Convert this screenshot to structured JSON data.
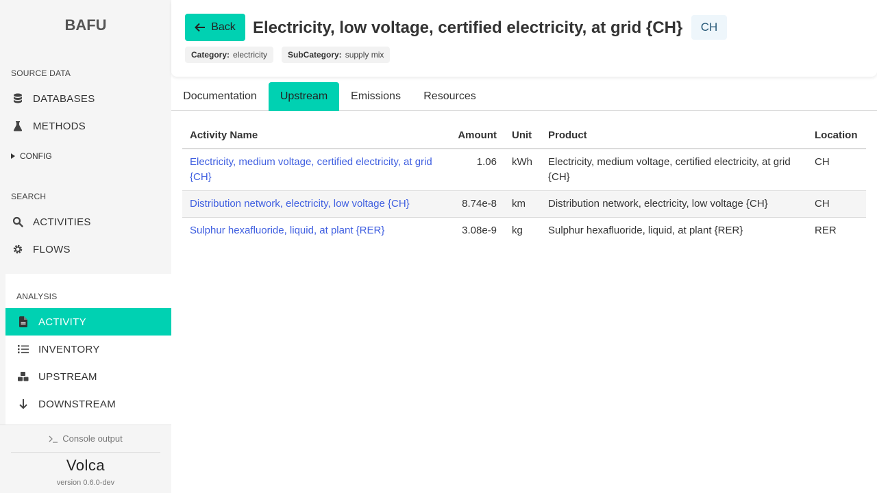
{
  "sidebar": {
    "brand": "BAFU",
    "source_label": "SOURCE DATA",
    "source_items": [
      {
        "label": "DATABASES",
        "icon": "database-icon"
      },
      {
        "label": "METHODS",
        "icon": "flask-icon"
      }
    ],
    "config_label": "CONFIG",
    "search_label": "SEARCH",
    "search_items": [
      {
        "label": "ACTIVITIES",
        "icon": "search-icon"
      },
      {
        "label": "FLOWS",
        "icon": "gear-icon"
      }
    ],
    "analysis_label": "ANALYSIS",
    "analysis_items": [
      {
        "label": "ACTIVITY",
        "icon": "document-icon",
        "active": true
      },
      {
        "label": "INVENTORY",
        "icon": "list-icon"
      },
      {
        "label": "UPSTREAM",
        "icon": "cubes-icon"
      },
      {
        "label": "DOWNSTREAM",
        "icon": "arrow-down-icon"
      }
    ],
    "console_label": "Console output",
    "logo": "Volca",
    "version": "version 0.6.0-dev"
  },
  "header": {
    "back_label": "Back",
    "title": "Electricity, low voltage, certified electricity, at grid {CH}",
    "location": "CH",
    "category_key": "Category:",
    "category_value": "electricity",
    "subcategory_key": "SubCategory:",
    "subcategory_value": "supply mix"
  },
  "tabs": [
    {
      "label": "Documentation"
    },
    {
      "label": "Upstream",
      "active": true
    },
    {
      "label": "Emissions"
    },
    {
      "label": "Resources"
    }
  ],
  "table": {
    "columns": [
      "Activity Name",
      "Amount",
      "Unit",
      "Product",
      "Location"
    ],
    "rows": [
      {
        "activity": "Electricity, medium voltage, certified electricity, at grid {CH}",
        "amount": "1.06",
        "unit": "kWh",
        "product": "Electricity, medium voltage, certified electricity, at grid {CH}",
        "location": "CH"
      },
      {
        "activity": "Distribution network, electricity, low voltage {CH}",
        "amount": "8.74e-8",
        "unit": "km",
        "product": "Distribution network, electricity, low voltage {CH}",
        "location": "CH"
      },
      {
        "activity": "Sulphur hexafluoride, liquid, at plant {RER}",
        "amount": "3.08e-9",
        "unit": "kg",
        "product": "Sulphur hexafluoride, liquid, at plant {RER}",
        "location": "RER"
      }
    ]
  },
  "colors": {
    "accent": "#00d1b2",
    "link": "#3e5ee0",
    "sidebar_bg": "#f5f5f5"
  }
}
